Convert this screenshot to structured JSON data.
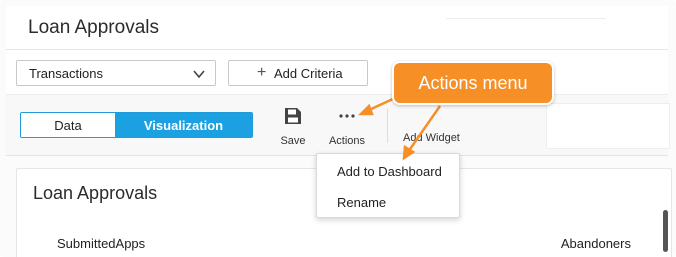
{
  "header": {
    "title": "Loan Approvals"
  },
  "criteria": {
    "dataset_value": "Transactions",
    "add_criteria_label": "Add Criteria"
  },
  "toolbar": {
    "tabs": [
      {
        "label": "Data"
      },
      {
        "label": "Visualization"
      }
    ],
    "save_label": "Save",
    "actions_label": "Actions",
    "add_widget_label": "Add Widget"
  },
  "actions_menu": {
    "items": [
      {
        "label": "Add to Dashboard"
      },
      {
        "label": "Rename"
      }
    ]
  },
  "card": {
    "title": "Loan Approvals",
    "left_column": "SubmittedApps",
    "right_column": "Abandoners"
  },
  "callout": {
    "text": "Actions menu"
  },
  "colors": {
    "accent": "#1ba1e2",
    "callout": "#f78f27"
  },
  "icons": {
    "save": "floppy-disk-icon",
    "actions": "ellipsis-icon",
    "dropdown": "chevron-down-icon",
    "add": "plus-icon"
  }
}
